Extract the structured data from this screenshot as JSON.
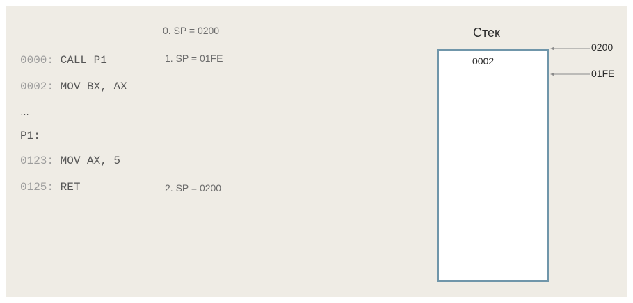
{
  "code": [
    {
      "addr": "0000:",
      "instr": " CALL P1"
    },
    {
      "addr": "0002:",
      "instr": " MOV BX, AX"
    },
    {
      "addr": "",
      "instr": "…"
    },
    {
      "addr": "",
      "instr": "P1:"
    },
    {
      "addr": "0123:",
      "instr": " MOV AX, 5"
    },
    {
      "addr": "0125:",
      "instr": " RET"
    }
  ],
  "sp_notes": [
    "0. SP = 0200",
    "1. SP = 01FE",
    "2. SP = 0200"
  ],
  "stack": {
    "title": "Стек",
    "cells": [
      "0002"
    ],
    "top_address": "0200",
    "pointer_address": "01FE"
  },
  "colors": {
    "background": "#efece5",
    "stack_border": "#7096aa",
    "address_text": "#9c9c9c",
    "code_text": "#555555"
  }
}
